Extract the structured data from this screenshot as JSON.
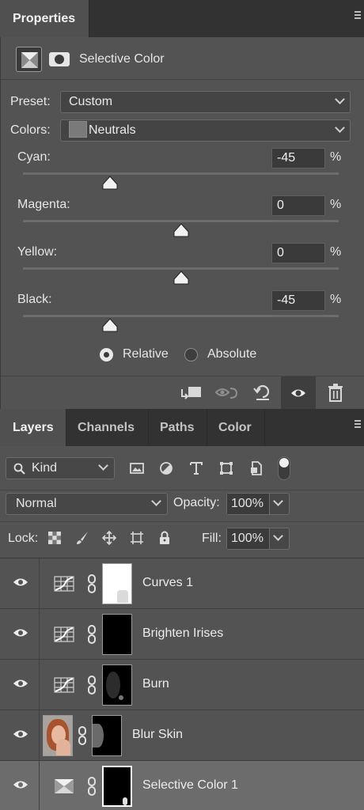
{
  "properties": {
    "tab_label": "Properties",
    "adjustment_title": "Selective Color",
    "preset_label": "Preset:",
    "preset_value": "Custom",
    "colors_label": "Colors:",
    "colors_value": "Neutrals",
    "sliders": [
      {
        "label": "Cyan:",
        "value": "-45",
        "unit": "%",
        "level": -45
      },
      {
        "label": "Magenta:",
        "value": "0",
        "unit": "%",
        "level": 0
      },
      {
        "label": "Yellow:",
        "value": "0",
        "unit": "%",
        "level": 0
      },
      {
        "label": "Black:",
        "value": "-45",
        "unit": "%",
        "level": -45
      }
    ],
    "method": {
      "relative": "Relative",
      "absolute": "Absolute",
      "selected": "relative"
    }
  },
  "layers_tabs": [
    "Layers",
    "Channels",
    "Paths",
    "Color"
  ],
  "layers_panel": {
    "kind_label": "Kind",
    "blend_mode": "Normal",
    "opacity_label": "Opacity:",
    "opacity_value": "100%",
    "lock_label": "Lock:",
    "fill_label": "Fill:",
    "fill_value": "100%",
    "layers": [
      {
        "name": "Curves 1",
        "type": "curves",
        "visible": true,
        "selected": false
      },
      {
        "name": "Brighten Irises",
        "type": "curves",
        "visible": true,
        "selected": false
      },
      {
        "name": "Burn",
        "type": "curves",
        "visible": true,
        "selected": false
      },
      {
        "name": "Blur Skin",
        "type": "pixel",
        "visible": true,
        "selected": false
      },
      {
        "name": "Selective Color 1",
        "type": "selective-color",
        "visible": true,
        "selected": true
      }
    ]
  }
}
